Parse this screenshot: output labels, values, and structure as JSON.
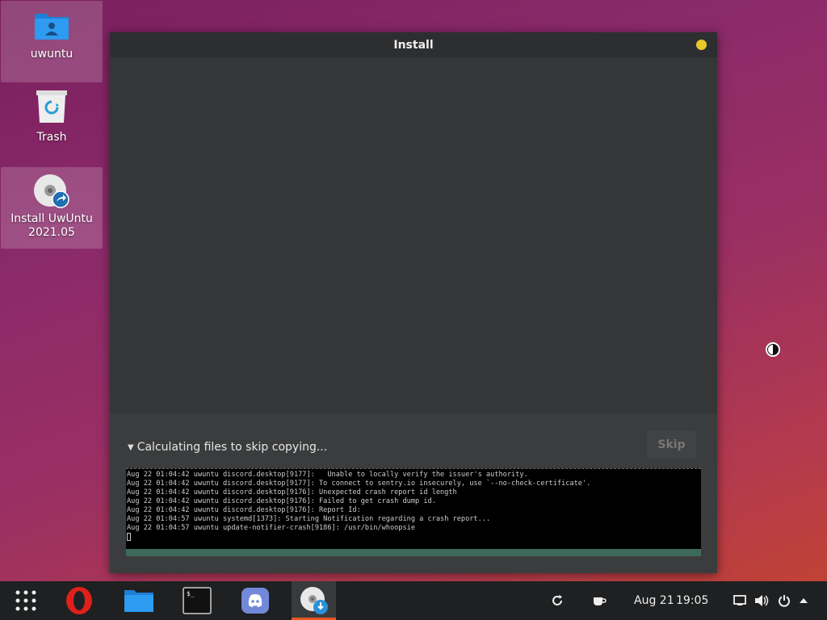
{
  "desktop": {
    "icons": [
      {
        "label": "uwuntu"
      },
      {
        "label": "Trash"
      },
      {
        "label": "Install UwUntu\n2021.05"
      }
    ]
  },
  "window": {
    "title": "Install",
    "status_label": "Calculating files to skip copying...",
    "skip_label": "Skip",
    "terminal_lines": [
      "Aug 22 01:04:42 uwuntu discord.desktop[9177]:   Unable to locally verify the issuer's authority.",
      "Aug 22 01:04:42 uwuntu discord.desktop[9177]: To connect to sentry.io insecurely, use `--no-check-certificate'.",
      "Aug 22 01:04:42 uwuntu discord.desktop[9176]: Unexpected crash report id length",
      "Aug 22 01:04:42 uwuntu discord.desktop[9176]: Failed to get crash dump id.",
      "Aug 22 01:04:42 uwuntu discord.desktop[9176]: Report Id:",
      "Aug 22 01:04:57 uwuntu systemd[1373]: Starting Notification regarding a crash report...",
      "Aug 22 01:04:57 uwuntu update-notifier-crash[9186]: /usr/bin/whoopsie"
    ]
  },
  "taskbar": {
    "apps": [
      "apps-grid-icon",
      "opera-icon",
      "files-icon",
      "terminal-icon",
      "discord-icon",
      "installer-icon"
    ],
    "date": "Aug 21",
    "time": "19:05"
  },
  "colors": {
    "accent": "#e95420",
    "title_dot": "#e6c72c",
    "progress": "#3d6a5c"
  }
}
